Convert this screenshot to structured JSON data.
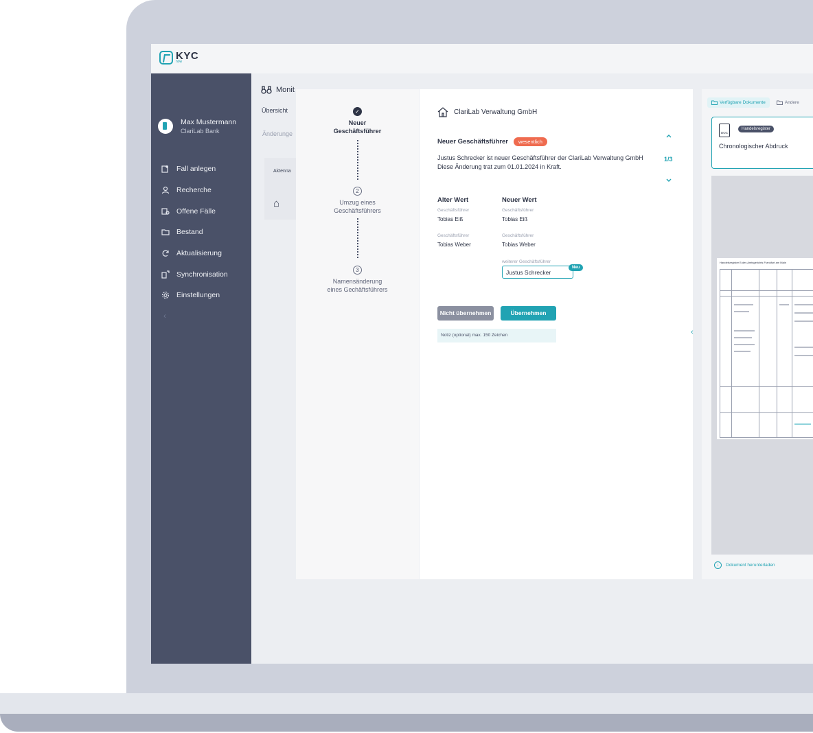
{
  "app": {
    "logo_text": "KYC",
    "logo_sub": "now"
  },
  "user": {
    "name": "Max Mustermann",
    "bank": "ClariLab Bank"
  },
  "sidebar": {
    "items": [
      {
        "label": "Fall anlegen",
        "icon": "add-case-icon"
      },
      {
        "label": "Recherche",
        "icon": "person-search-icon"
      },
      {
        "label": "Offene Fälle",
        "icon": "open-cases-icon"
      },
      {
        "label": "Bestand",
        "icon": "folder-icon"
      },
      {
        "label": "Aktualisierung",
        "icon": "refresh-icon"
      },
      {
        "label": "Synchronisation",
        "icon": "sync-icon"
      },
      {
        "label": "Einstellungen",
        "icon": "gear-icon"
      }
    ],
    "collapse_icon": "chevron-left-icon"
  },
  "background": {
    "title": "Monit",
    "tab_overview": "Übersicht",
    "tab_changes": "Änderunge",
    "column": "Aktenna"
  },
  "stepper": {
    "steps": [
      {
        "marker": "✓",
        "label_line1": "Neuer",
        "label_line2": "Geschäftsführer",
        "active": true
      },
      {
        "marker": "2",
        "label_line1": "Umzug eines",
        "label_line2": "Geschäftsführers",
        "active": false
      },
      {
        "marker": "3",
        "label_line1": "Namensänderung",
        "label_line2": "eines Gechäftsführers",
        "active": false
      }
    ]
  },
  "detail": {
    "company": "ClariLab Verwaltung GmbH",
    "change_title": "Neuer Geschäftsführer",
    "badge": "wesentlich",
    "pager": "1/3",
    "description": "Justus Schrecker ist neuer Geschäftsführer der ClariLab Verwaltung GmbH  Diese Änderung trat zum 01.01.2024 in Kraft.",
    "old_header": "Alter Wert",
    "new_header": "Neuer Wert",
    "old_rows": [
      {
        "label": "Geschäftsführer",
        "value": "Tobias Eiß"
      },
      {
        "label": "Geschäftsführer",
        "value": "Tobias Weber"
      }
    ],
    "new_rows": [
      {
        "label": "Geschäftsführer",
        "value": "Tobias Eiß"
      },
      {
        "label": "Geschäftsführer",
        "value": "Tobias Weber"
      }
    ],
    "new_field_label": "weiterer Geschäftsführer",
    "new_field_value": "Justus Schrecker",
    "new_badge": "Neu",
    "btn_reject": "Nicht übernehmen",
    "btn_accept": "Übernehmen",
    "note_placeholder": "Notiz (optional) max. 150 Zeichen"
  },
  "documents": {
    "tab_available": "Verfügbare Dokumente",
    "tab_other": "Andere",
    "card_badge": "Handelsregister",
    "card_title": "Chronologischer Abdruck",
    "file_type": "DOC",
    "page_title": "Handelsregister B des Amtsgerichts Frankfurt am Main",
    "download": "Dokument herunterladen"
  }
}
